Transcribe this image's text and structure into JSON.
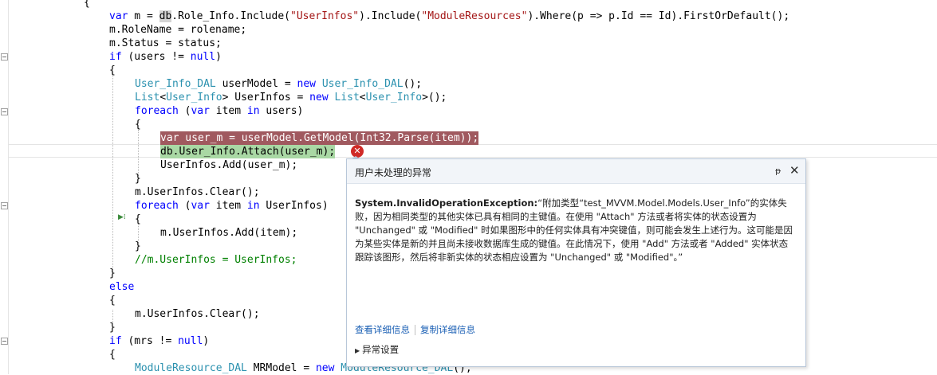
{
  "code": {
    "brace_top": "{",
    "l1_a": "var",
    "l1_b": " m = ",
    "l1_db": "db",
    "l1_c": ".Role_Info.Include(",
    "l1_s1": "\"UserInfos\"",
    "l1_d": ").Include(",
    "l1_s2": "\"ModuleResources\"",
    "l1_e": ").Where(p => p.Id == Id).FirstOrDefault();",
    "l2": "m.RoleName = rolename;",
    "l3": "m.Status = status;",
    "l4_a": "if",
    "l4_b": " (users != ",
    "l4_c": "null",
    "l4_d": ")",
    "l5": "{",
    "l6_t1": "User_Info_DAL",
    "l6_b": " userModel = ",
    "l6_k": "new",
    "l6_sp": " ",
    "l6_t2": "User_Info_DAL",
    "l6_c": "();",
    "l7_t1": "List",
    "l7_lt": "<",
    "l7_t2": "User_Info",
    "l7_b": "> UserInfos = ",
    "l7_k": "new",
    "l7_sp": " ",
    "l7_t3": "List",
    "l7_lt2": "<",
    "l7_t4": "User_Info",
    "l7_c": ">();",
    "l8_k1": "foreach",
    "l8_b": " (",
    "l8_k2": "var",
    "l8_c": " item ",
    "l8_k3": "in",
    "l8_d": " users)",
    "l9": "{",
    "l10_k": "var",
    "l10_b": " user_m = userModel.GetModel(Int32.Parse(item));",
    "l11": "db.User_Info.Attach(user_m);",
    "l12": "UserInfos.Add(user_m);",
    "l13": "}",
    "l14": "m.UserInfos.Clear();",
    "l15_k1": "foreach",
    "l15_b": " (",
    "l15_k2": "var",
    "l15_c": " item ",
    "l15_k3": "in",
    "l15_d": " UserInfos)",
    "l16": "{",
    "l17": "m.UserInfos.Add(item);",
    "l18": "}",
    "l19": "//m.UserInfos = UserInfos;",
    "l20": "}",
    "l21": "else",
    "l22": "{",
    "l23": "m.UserInfos.Clear();",
    "l24": "}",
    "l25_a": "if",
    "l25_b": " (mrs != ",
    "l25_c": "null",
    "l25_d": ")",
    "l26": "{",
    "l27_t1": "ModuleResource_DAL",
    "l27_b": " MRModel = ",
    "l27_k": "new",
    "l27_sp": " ",
    "l27_t2": "ModuleResource_DAL",
    "l27_c": "();"
  },
  "popup": {
    "title": "用户未处理的异常",
    "pin_icon": "pin-icon",
    "close_icon": "close-icon",
    "exception_type": "System.InvalidOperationException:",
    "message": "“附加类型“test_MVVM.Model.Models.User_Info”的实体失败，因为相同类型的其他实体已具有相同的主键值。在使用 \"Attach\" 方法或者将实体的状态设置为 \"Unchanged\" 或 \"Modified\" 时如果图形中的任何实体具有冲突键值，则可能会发生上述行为。这可能是因为某些实体是新的并且尚未接收数据库生成的键值。在此情况下，使用 \"Add\" 方法或者 \"Added\" 实体状态跟踪该图形，然后将非新实体的状态相应设置为 \"Unchanged\" 或 \"Modified\"。”",
    "view_details": "查看详细信息",
    "copy_details": "复制详细信息",
    "exception_settings": "异常设置"
  },
  "colors": {
    "keyword": "#0000ff",
    "string": "#a31515",
    "type": "#2b91af",
    "comment": "#008000",
    "error_highlight": "#a0595f",
    "current_statement": "#a9d8a4"
  }
}
